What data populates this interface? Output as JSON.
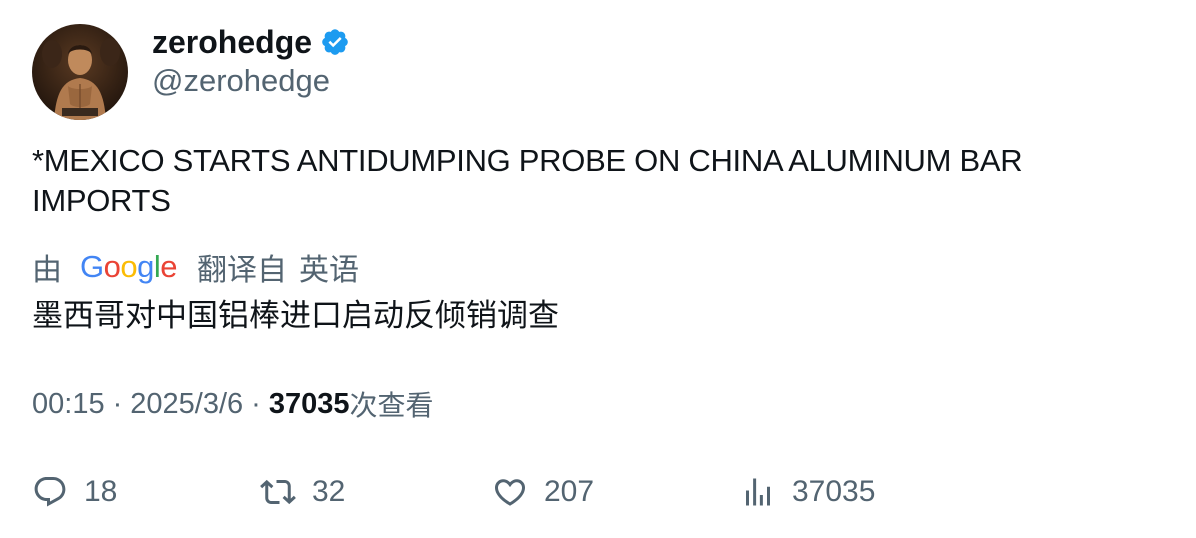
{
  "author": {
    "display_name": "zerohedge",
    "handle": "@zerohedge",
    "verified_icon": "verified-badge-icon",
    "verified_color": "#1d9bf0"
  },
  "tweet": {
    "text": "*MEXICO STARTS ANTIDUMPING PROBE ON CHINA ALUMINUM BAR IMPORTS"
  },
  "translation": {
    "by_label": "由",
    "provider": "Google",
    "from_label": "翻译自",
    "language": "英语",
    "text": "墨西哥对中国铝棒进口启动反倾销调查"
  },
  "meta": {
    "time": "00:15",
    "separator": "·",
    "date": "2025/3/6",
    "views_count": "37035",
    "views_label": "次查看"
  },
  "actions": {
    "reply_count": "18",
    "retweet_count": "32",
    "like_count": "207",
    "views_count": "37035"
  },
  "colors": {
    "text_primary": "#0f1419",
    "text_secondary": "#536471",
    "google_blue": "#4285F4",
    "google_red": "#EA4335",
    "google_yellow": "#FBBC05",
    "google_green": "#34A853"
  }
}
